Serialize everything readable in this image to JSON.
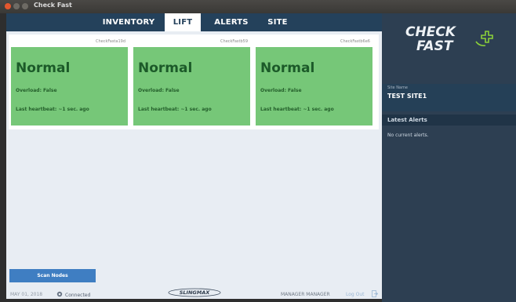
{
  "window": {
    "title": "Check Fast"
  },
  "tabs": [
    {
      "label": "INVENTORY",
      "active": false
    },
    {
      "label": "LIFT",
      "active": true
    },
    {
      "label": "ALERTS",
      "active": false
    },
    {
      "label": "SITE",
      "active": false
    }
  ],
  "cards": [
    {
      "id": "CheckFasta19d",
      "status": "Normal",
      "overload": "Overload: False",
      "heartbeat": "Last heartbeat: ~1 sec. ago"
    },
    {
      "id": "CheckFastb59",
      "status": "Normal",
      "overload": "Overload: False",
      "heartbeat": "Last heartbeat: ~1 sec. ago"
    },
    {
      "id": "CheckFastb6e6",
      "status": "Normal",
      "overload": "Overload: False",
      "heartbeat": "Last heartbeat: ~1 sec. ago"
    }
  ],
  "footer": {
    "scan_label": "Scan Nodes",
    "date": "MAY 01, 2018",
    "connection": "Connected",
    "logo_text": "SLINGMAX",
    "user": "MANAGER MANAGER",
    "logout": "Log Out"
  },
  "sidebar": {
    "logo_line1": "CHECK",
    "logo_line2": "FAST",
    "site_label": "Site Name",
    "site_name": "TEST SITE1",
    "alerts_title": "Latest Alerts",
    "alerts_empty": "No current alerts."
  },
  "colors": {
    "nav": "#24415b",
    "card_normal": "#76c778",
    "sidebar": "#2d3f52",
    "logo_accent": "#8bd13a"
  }
}
